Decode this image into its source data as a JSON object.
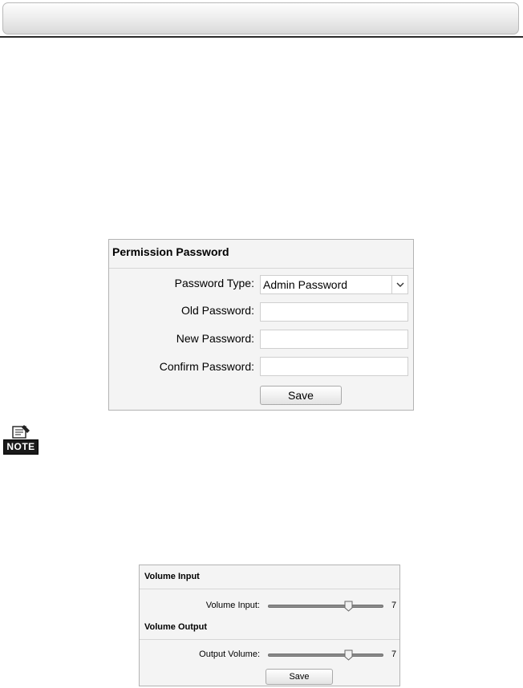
{
  "permission": {
    "title": "Permission Password",
    "password_type_label": "Password Type:",
    "password_type_value": "Admin Password",
    "old_password_label": "Old Password:",
    "old_password_value": "",
    "new_password_label": "New Password:",
    "new_password_value": "",
    "confirm_password_label": "Confirm Password:",
    "confirm_password_value": "",
    "save_label": "Save"
  },
  "note": {
    "badge_label": "NOTE"
  },
  "volume": {
    "input_section_title": "Volume Input",
    "input_label": "Volume Input:",
    "input_value": "7",
    "input_level": 0.7,
    "output_section_title": "Volume Output",
    "output_label": "Output Volume:",
    "output_value": "7",
    "output_level": 0.7,
    "save_label": "Save"
  }
}
